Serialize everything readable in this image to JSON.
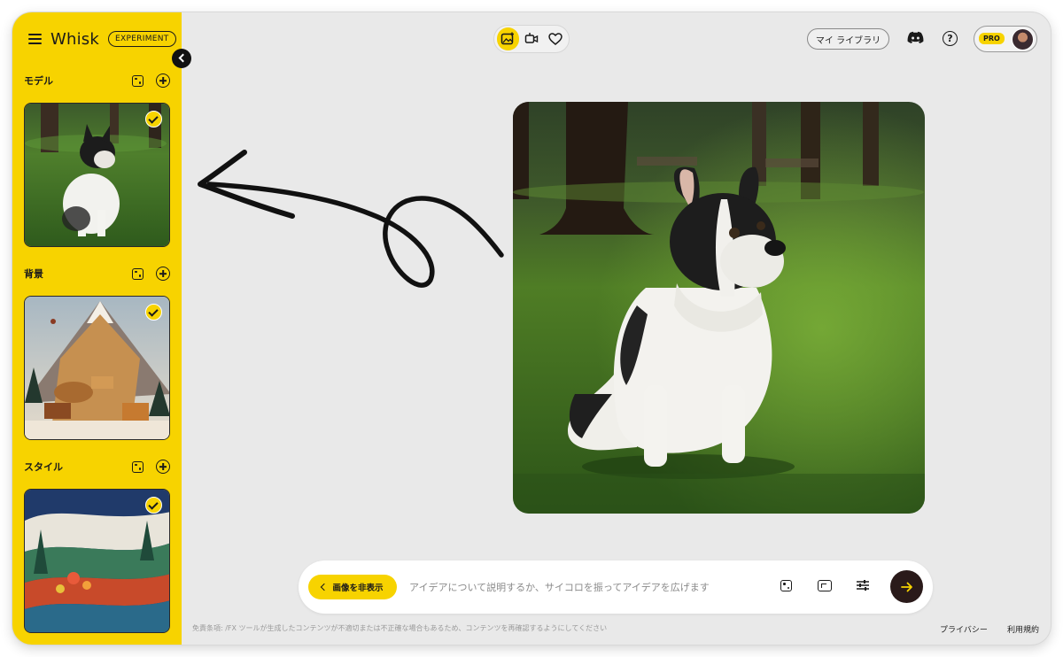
{
  "app": {
    "name": "Whisk",
    "badge": "EXPERIMENT"
  },
  "sidebar": {
    "sections": [
      {
        "title": "モデル",
        "selected": true
      },
      {
        "title": "背景",
        "selected": true
      },
      {
        "title": "スタイル",
        "selected": true
      }
    ]
  },
  "topbar": {
    "mode_icons": [
      "image-generate-icon",
      "video-icon",
      "heart-icon"
    ],
    "library_label": "マイ ライブラリ",
    "pro_label": "PRO"
  },
  "prompt": {
    "hide_images_label": "画像を非表示",
    "placeholder": "アイデアについて説明するか、サイコロを振ってアイデアを広げます"
  },
  "footer": {
    "disclaimer": "免責条項: /FX ツールが生成したコンテンツが不適切または不正確な場合もあるため、コンテンツを再確認するようにしてください",
    "privacy": "プライバシー",
    "terms": "利用規約"
  },
  "colors": {
    "accent": "#f7d300",
    "canvas": "#e9e9e9",
    "submit": "#2a1a1a"
  }
}
